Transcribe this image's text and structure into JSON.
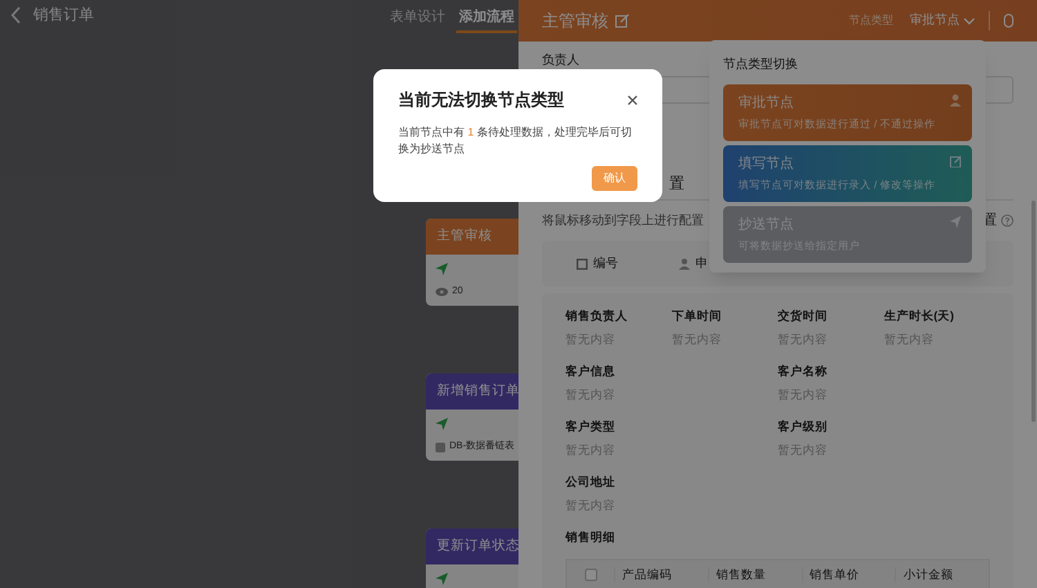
{
  "top_bar": {
    "title": "销售订单",
    "tabs": [
      {
        "label": "表单设计",
        "selected": false
      },
      {
        "label": "添加流程",
        "selected": true
      }
    ]
  },
  "canvas": {
    "nodes": [
      {
        "kind": "approve",
        "title": "主管审核",
        "lines": [
          {
            "kind": "send"
          },
          {
            "kind": "eye",
            "text": "20"
          }
        ]
      },
      {
        "kind": "data",
        "title": "新增销售订单",
        "lines": [
          {
            "kind": "send"
          },
          {
            "kind": "db",
            "text": "DB-数据番链表"
          }
        ]
      },
      {
        "kind": "data",
        "title": "更新订单状态",
        "lines": [
          {
            "kind": "send"
          }
        ]
      }
    ]
  },
  "drawer": {
    "title": "主管审核",
    "type_label": "节点类型",
    "type_value": "审批节点",
    "owner_label": "负责人",
    "tabs": [
      {
        "label": "置",
        "selected": false
      }
    ],
    "hint": "将鼠标移动到字段上进行配置",
    "right_fragment": "置",
    "chips": [
      {
        "kind": "number",
        "label": "编号"
      },
      {
        "kind": "person",
        "label": "申"
      }
    ],
    "fields": [
      {
        "label": "销售负责人",
        "value": "暂无内容"
      },
      {
        "label": "下单时间",
        "value": "暂无内容"
      },
      {
        "label": "交货时间",
        "value": "暂无内容"
      },
      {
        "label": "生产时长(天)",
        "value": "暂无内容"
      },
      {
        "label": "客户信息",
        "value": "暂无内容"
      },
      {
        "label": "客户名称",
        "value": "暂无内容"
      },
      {
        "label": "客户类型",
        "value": "暂无内容"
      },
      {
        "label": "客户级别",
        "value": "暂无内容"
      },
      {
        "label": "公司地址",
        "value": "暂无内容"
      }
    ],
    "detail_title": "销售明细",
    "detail_all_checked": false,
    "detail_columns": [
      "产品编码",
      "销售数量",
      "销售单价",
      "小计金额"
    ]
  },
  "type_menu": {
    "title": "节点类型切换",
    "options": [
      {
        "kind": "approve",
        "name": "审批节点",
        "description": "审批节点可对数据进行通过 / 不通过操作"
      },
      {
        "kind": "fill",
        "name": "填写节点",
        "description": "填写节点可对数据进行录入 / 修改等操作"
      },
      {
        "kind": "cc",
        "name": "抄送节点",
        "description": "可将数据抄送给指定用户"
      }
    ]
  },
  "dialog": {
    "title": "当前无法切换节点类型",
    "message_before": "当前节点中有",
    "count": "1",
    "message_after": "条待处理数据，处理完毕后可切换为抄送节点",
    "confirm": "确认"
  }
}
